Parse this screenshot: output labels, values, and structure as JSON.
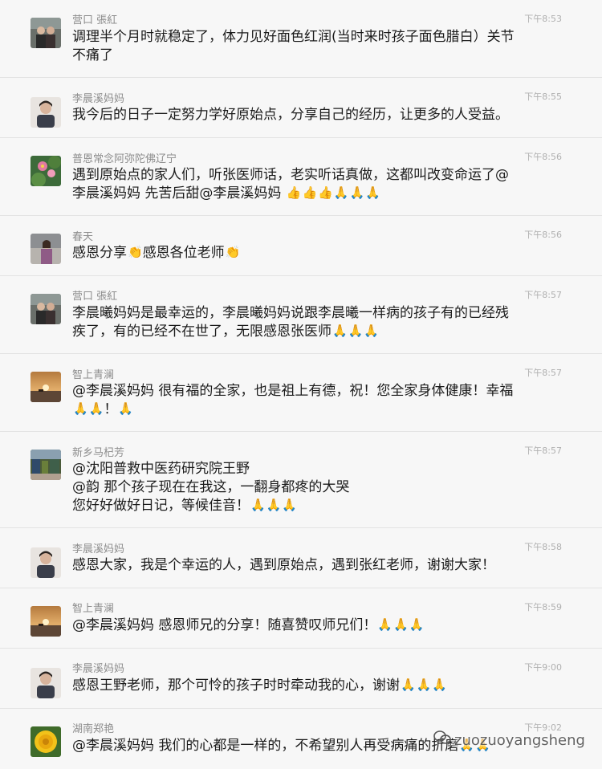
{
  "messages": [
    {
      "name": "营口 張紅",
      "time": "下午8:53",
      "lines": [
        "调理半个月时就稳定了，体力见好面色红润(当时来时孩子面色腊白）关节",
        "不痛了"
      ]
    },
    {
      "name": "李晨溪妈妈",
      "time": "下午8:55",
      "lines": [
        "我今后的日子一定努力学好原始点，分享自己的经历，让更多的人受益。"
      ]
    },
    {
      "name": "普恩常念阿弥陀佛辽宁",
      "time": "下午8:56",
      "lines": [
        "遇到原始点的家人们，听张医师话，老实听话真做，这都叫改变命运了@",
        "李晨溪妈妈 先苦后甜@李晨溪妈妈 "
      ]
    },
    {
      "name": "春天",
      "time": "下午8:56",
      "lines": [
        "感恩分享",
        "感恩各位老师"
      ]
    },
    {
      "name": "营口 張紅",
      "time": "下午8:57",
      "lines": [
        "李晨曦妈妈是最幸运的，李晨曦妈妈说跟李晨曦一样病的孩子有的已经残",
        "疾了，有的已经不在世了，无限感恩张医师"
      ]
    },
    {
      "name": "智上青澜",
      "time": "下午8:57",
      "lines": [
        "@李晨溪妈妈 很有福的全家，也是祖上有德，祝！您全家身体健康！幸福",
        "！"
      ]
    },
    {
      "name": "新乡马杞芳",
      "time": "下午8:57",
      "lines": [
        "@沈阳普救中医药研究院王野",
        "@韵 那个孩子现在在我这，一翻身都疼的大哭",
        "您好好做好日记，等候佳音！"
      ]
    },
    {
      "name": "李晨溪妈妈",
      "time": "下午8:58",
      "lines": [
        "感恩大家，我是个幸运的人，遇到原始点，遇到张红老师，谢谢大家！"
      ]
    },
    {
      "name": "智上青澜",
      "time": "下午8:59",
      "lines": [
        "@李晨溪妈妈 感恩师兄的分享！随喜赞叹师兄们！"
      ]
    },
    {
      "name": "李晨溪妈妈",
      "time": "下午9:00",
      "lines": [
        "感恩王野老师，那个可怜的孩子时时牵动我的心，谢谢"
      ]
    },
    {
      "name": "湖南郑艳",
      "time": "下午9:02",
      "lines": [
        "@李晨溪妈妈 我们的心都是一样的，不希望别人再受病痛的折磨"
      ]
    }
  ],
  "emoji": {
    "hands": "🙏",
    "thumbs": "👍",
    "wave": "👏"
  },
  "watermark": {
    "icon": "chat-bubble-icon",
    "text": "zuozuoyangsheng"
  }
}
